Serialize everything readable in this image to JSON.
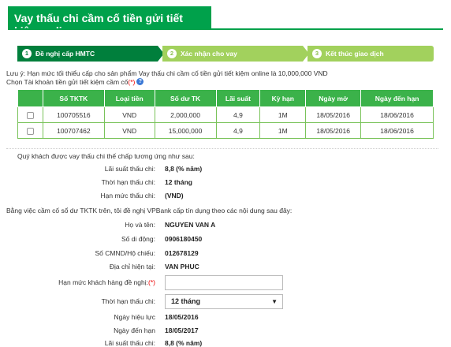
{
  "page": {
    "title": "Vay thấu chi cầm cố tiền gửi tiết kiệm online"
  },
  "steps": [
    {
      "num": "1",
      "label": "Đề nghị cấp HMTC"
    },
    {
      "num": "2",
      "label": "Xác nhận cho vay"
    },
    {
      "num": "3",
      "label": "Kết thúc giao dịch"
    }
  ],
  "note": "Lưu ý: Hạn mức tối thiểu cấp cho sản phẩm Vay thấu chi cầm cố tiền gửi tiết kiệm online là 10,000,000 VND",
  "choose_account": {
    "label": "Chọn Tài khoản tiền gửi tiết kiệm cầm cố",
    "required": "(*)"
  },
  "table": {
    "headers": [
      "",
      "Số TKTK",
      "Loại tiền",
      "Số dư TK",
      "Lãi suất",
      "Kỳ hạn",
      "Ngày mở",
      "Ngày đến hạn"
    ],
    "rows": [
      {
        "account": "100705516",
        "currency": "VND",
        "balance": "2,000,000",
        "rate": "4,9",
        "term": "1M",
        "open_date": "18/05/2016",
        "due_date": "18/06/2016"
      },
      {
        "account": "100707462",
        "currency": "VND",
        "balance": "15,000,000",
        "rate": "4,9",
        "term": "1M",
        "open_date": "18/05/2016",
        "due_date": "18/06/2016"
      }
    ]
  },
  "section1": {
    "intro": "Quý khách được vay thấu chi thế chấp tương ứng như sau:",
    "rate_label": "Lãi suất thấu chi:",
    "rate_value": "8,8 (% năm)",
    "term_label": "Thời hạn thấu chi:",
    "term_value": "12 tháng",
    "limit_label": "Hạn mức thấu chi:",
    "limit_value": "(VND)"
  },
  "section2": {
    "intro": "Bằng việc cầm cố sổ dư TKTK trên, tôi đề nghị VPBank cấp tín dụng theo các nội dung sau đây:",
    "name_label": "Họ và tên:",
    "name_value": "NGUYEN VAN A",
    "phone_label": "Số di động:",
    "phone_value": "0906180450",
    "id_label": "Số CMND/Hộ chiếu:",
    "id_value": "012678129",
    "address_label": "Địa chỉ hiện tại:",
    "address_value": "VAN PHUC",
    "requested_limit_label": "Hạn mức khách hàng đề nghị:",
    "requested_limit_required": "(*)",
    "requested_limit_value": "",
    "od_term_label": "Thời hạn thấu chi:",
    "od_term_selected": "12 tháng",
    "effective_label": "Ngày hiệu lực",
    "effective_value": "18/05/2016",
    "due_label": "Ngày đến hạn",
    "due_value": "18/05/2017",
    "rate_label": "Lãi suất thấu chi:",
    "rate_value": "8,8 (% năm)"
  },
  "colors": {
    "brand_green": "#00a14b",
    "step_active": "#007f3c",
    "step_inactive": "#a2d15d",
    "table_header": "#3bb24a",
    "required": "#e00000"
  }
}
